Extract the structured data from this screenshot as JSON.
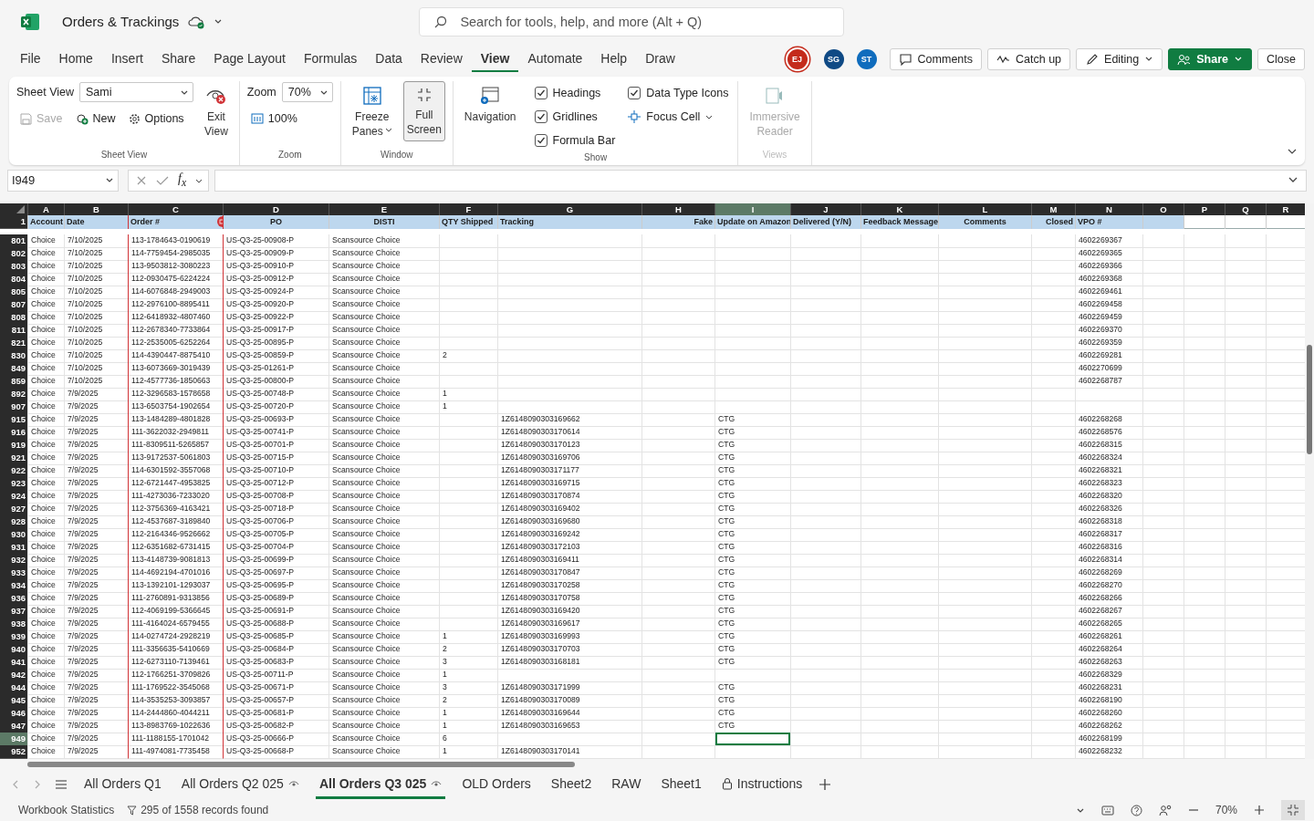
{
  "app": {
    "title": "Orders & Trackings",
    "search_placeholder": "Search for tools, help, and more (Alt + Q)"
  },
  "menu": [
    {
      "label": "File",
      "selected": false
    },
    {
      "label": "Home",
      "selected": false
    },
    {
      "label": "Insert",
      "selected": false
    },
    {
      "label": "Share",
      "selected": false
    },
    {
      "label": "Page Layout",
      "selected": false
    },
    {
      "label": "Formulas",
      "selected": false
    },
    {
      "label": "Data",
      "selected": false
    },
    {
      "label": "Review",
      "selected": false
    },
    {
      "label": "View",
      "selected": true
    },
    {
      "label": "Automate",
      "selected": false
    },
    {
      "label": "Help",
      "selected": false
    },
    {
      "label": "Draw",
      "selected": false
    }
  ],
  "presence": [
    {
      "initials": "EJ",
      "color": "#c42b1c"
    },
    {
      "initials": "SG",
      "color": "#0f4a85"
    },
    {
      "initials": "ST",
      "color": "#0f6cbd"
    }
  ],
  "header_buttons": [
    {
      "kind": "comments",
      "label": "Comments"
    },
    {
      "kind": "catchup",
      "label": "Catch up"
    },
    {
      "kind": "editing",
      "label": "Editing"
    },
    {
      "kind": "share",
      "label": "Share"
    },
    {
      "kind": "close",
      "label": "Close"
    }
  ],
  "ribbon": {
    "sheet_view": {
      "label": "Sheet View",
      "value": "Sami",
      "save": {
        "label": "Save",
        "disabled": true
      },
      "new": "New",
      "options": "Options",
      "exit": [
        "Exit",
        "View"
      ],
      "group": "Sheet View"
    },
    "zoom": {
      "label": "Zoom",
      "value": "70%",
      "hundred": "100%",
      "group": "Zoom"
    },
    "window": {
      "freeze": [
        "Freeze",
        "Panes"
      ],
      "full_screen": {
        "lines": [
          "Full",
          "Screen"
        ],
        "selected": true
      },
      "group": "Window"
    },
    "show": {
      "navigation": "Navigation",
      "checks": [
        {
          "label": "Headings",
          "checked": true
        },
        {
          "label": "Gridlines",
          "checked": true
        },
        {
          "label": "Formula Bar",
          "checked": true
        },
        {
          "label": "Data Type Icons",
          "checked": true
        }
      ],
      "focus_cell": "Focus Cell",
      "group": "Show"
    },
    "views": {
      "reader": {
        "lines": [
          "Immersive",
          "Reader"
        ],
        "disabled": true
      },
      "group": "Views",
      "disabled": true
    }
  },
  "formula_bar": {
    "name_box": "I949",
    "fx": "f$_{x}$"
  },
  "sheet": {
    "columns": [
      {
        "letter": "A",
        "heading": "Account",
        "selected": false
      },
      {
        "letter": "B",
        "heading": "Date",
        "selected": false
      },
      {
        "letter": "C",
        "heading": "Order #",
        "selected": false
      },
      {
        "letter": "D",
        "heading": "PO",
        "selected": false
      },
      {
        "letter": "E",
        "heading": "DISTI",
        "selected": false
      },
      {
        "letter": "F",
        "heading": "QTY Shipped",
        "selected": false
      },
      {
        "letter": "G",
        "heading": "Tracking",
        "selected": false
      },
      {
        "letter": "H",
        "heading": "Fake",
        "selected": false
      },
      {
        "letter": "I",
        "heading": "Update on Amazon",
        "selected": true
      },
      {
        "letter": "J",
        "heading": "Delivered (Y/N)",
        "selected": false
      },
      {
        "letter": "K",
        "heading": "Feedback Message",
        "selected": false
      },
      {
        "letter": "L",
        "heading": "Comments",
        "selected": false
      },
      {
        "letter": "M",
        "heading": "Closed",
        "selected": false
      },
      {
        "letter": "N",
        "heading": "VPO #",
        "selected": false
      },
      {
        "letter": "O",
        "selected": false
      },
      {
        "letter": "P",
        "selected": false
      },
      {
        "letter": "Q",
        "selected": false
      },
      {
        "letter": "R",
        "selected": false
      }
    ],
    "header_row": "1",
    "rows": [
      {
        "row": "801",
        "selected": false,
        "account": "Choice",
        "date": "7/10/2025",
        "order": "113-1784643-0190619",
        "po": "US-Q3-25-00908-P",
        "disti": "Scansource Choice",
        "vpo": "4602269367"
      },
      {
        "row": "802",
        "selected": false,
        "account": "Choice",
        "date": "7/10/2025",
        "order": "114-7759454-2985035",
        "po": "US-Q3-25-00909-P",
        "disti": "Scansource Choice",
        "vpo": "4602269365"
      },
      {
        "row": "803",
        "selected": false,
        "account": "Choice",
        "date": "7/10/2025",
        "order": "113-9503812-3080223",
        "po": "US-Q3-25-00910-P",
        "disti": "Scansource Choice",
        "vpo": "4602269366"
      },
      {
        "row": "804",
        "selected": false,
        "account": "Choice",
        "date": "7/10/2025",
        "order": "112-0930475-6224224",
        "po": "US-Q3-25-00912-P",
        "disti": "Scansource Choice",
        "vpo": "4602269368"
      },
      {
        "row": "805",
        "selected": false,
        "account": "Choice",
        "date": "7/10/2025",
        "order": "114-6076848-2949003",
        "po": "US-Q3-25-00924-P",
        "disti": "Scansource Choice",
        "vpo": "4602269461"
      },
      {
        "row": "807",
        "selected": false,
        "account": "Choice",
        "date": "7/10/2025",
        "order": "112-2976100-8895411",
        "po": "US-Q3-25-00920-P",
        "disti": "Scansource Choice",
        "vpo": "4602269458"
      },
      {
        "row": "808",
        "selected": false,
        "account": "Choice",
        "date": "7/10/2025",
        "order": "112-6418932-4807460",
        "po": "US-Q3-25-00922-P",
        "disti": "Scansource Choice",
        "vpo": "4602269459"
      },
      {
        "row": "811",
        "selected": false,
        "account": "Choice",
        "date": "7/10/2025",
        "order": "112-2678340-7733864",
        "po": "US-Q3-25-00917-P",
        "disti": "Scansource Choice",
        "vpo": "4602269370"
      },
      {
        "row": "821",
        "selected": false,
        "account": "Choice",
        "date": "7/10/2025",
        "order": "112-2535005-6252264",
        "po": "US-Q3-25-00895-P",
        "disti": "Scansource Choice",
        "vpo": "4602269359"
      },
      {
        "row": "830",
        "selected": false,
        "account": "Choice",
        "date": "7/10/2025",
        "order": "114-4390447-8875410",
        "po": "US-Q3-25-00859-P",
        "disti": "Scansource Choice",
        "qty": "2",
        "vpo": "4602269281"
      },
      {
        "row": "849",
        "selected": false,
        "account": "Choice",
        "date": "7/10/2025",
        "order": "113-6073669-3019439",
        "po": "US-Q3-25-01261-P",
        "disti": "Scansource Choice",
        "vpo": "4602270699"
      },
      {
        "row": "859",
        "selected": false,
        "account": "Choice",
        "date": "7/10/2025",
        "order": "112-4577736-1850663",
        "po": "US-Q3-25-00800-P",
        "disti": "Scansource Choice",
        "vpo": "4602268787"
      },
      {
        "row": "892",
        "selected": false,
        "account": "Choice",
        "date": "7/9/2025",
        "order": "112-3296583-1578658",
        "po": "US-Q3-25-00748-P",
        "disti": "Scansource Choice",
        "qty": "1"
      },
      {
        "row": "907",
        "selected": false,
        "account": "Choice",
        "date": "7/9/2025",
        "order": "113-6503754-1902654",
        "po": "US-Q3-25-00720-P",
        "disti": "Scansource Choice",
        "qty": "1"
      },
      {
        "row": "915",
        "selected": false,
        "account": "Choice",
        "date": "7/9/2025",
        "order": "113-1484289-4801828",
        "po": "US-Q3-25-00693-P",
        "disti": "Scansource Choice",
        "tracking": "1Z6148090303169662",
        "update": "CTG",
        "vpo": "4602268268"
      },
      {
        "row": "916",
        "selected": false,
        "account": "Choice",
        "date": "7/9/2025",
        "order": "111-3622032-2949811",
        "po": "US-Q3-25-00741-P",
        "disti": "Scansource Choice",
        "tracking": "1Z6148090303170614",
        "update": "CTG",
        "vpo": "4602268576"
      },
      {
        "row": "919",
        "selected": false,
        "account": "Choice",
        "date": "7/9/2025",
        "order": "111-8309511-5265857",
        "po": "US-Q3-25-00701-P",
        "disti": "Scansource Choice",
        "tracking": "1Z6148090303170123",
        "update": "CTG",
        "vpo": "4602268315"
      },
      {
        "row": "921",
        "selected": false,
        "account": "Choice",
        "date": "7/9/2025",
        "order": "113-9172537-5061803",
        "po": "US-Q3-25-00715-P",
        "disti": "Scansource Choice",
        "tracking": "1Z6148090303169706",
        "update": "CTG",
        "vpo": "4602268324"
      },
      {
        "row": "922",
        "selected": false,
        "account": "Choice",
        "date": "7/9/2025",
        "order": "114-6301592-3557068",
        "po": "US-Q3-25-00710-P",
        "disti": "Scansource Choice",
        "tracking": "1Z6148090303171177",
        "update": "CTG",
        "vpo": "4602268321"
      },
      {
        "row": "923",
        "selected": false,
        "account": "Choice",
        "date": "7/9/2025",
        "order": "112-6721447-4953825",
        "po": "US-Q3-25-00712-P",
        "disti": "Scansource Choice",
        "tracking": "1Z6148090303169715",
        "update": "CTG",
        "vpo": "4602268323"
      },
      {
        "row": "924",
        "selected": false,
        "account": "Choice",
        "date": "7/9/2025",
        "order": "111-4273036-7233020",
        "po": "US-Q3-25-00708-P",
        "disti": "Scansource Choice",
        "tracking": "1Z6148090303170874",
        "update": "CTG",
        "vpo": "4602268320"
      },
      {
        "row": "927",
        "selected": false,
        "account": "Choice",
        "date": "7/9/2025",
        "order": "112-3756369-4163421",
        "po": "US-Q3-25-00718-P",
        "disti": "Scansource Choice",
        "tracking": "1Z6148090303169402",
        "update": "CTG",
        "vpo": "4602268326"
      },
      {
        "row": "928",
        "selected": false,
        "account": "Choice",
        "date": "7/9/2025",
        "order": "112-4537687-3189840",
        "po": "US-Q3-25-00706-P",
        "disti": "Scansource Choice",
        "tracking": "1Z6148090303169680",
        "update": "CTG",
        "vpo": "4602268318"
      },
      {
        "row": "930",
        "selected": false,
        "account": "Choice",
        "date": "7/9/2025",
        "order": "112-2164346-9526662",
        "po": "US-Q3-25-00705-P",
        "disti": "Scansource Choice",
        "tracking": "1Z6148090303169242",
        "update": "CTG",
        "vpo": "4602268317"
      },
      {
        "row": "931",
        "selected": false,
        "account": "Choice",
        "date": "7/9/2025",
        "order": "112-6351682-6731415",
        "po": "US-Q3-25-00704-P",
        "disti": "Scansource Choice",
        "tracking": "1Z6148090303172103",
        "update": "CTG",
        "vpo": "4602268316"
      },
      {
        "row": "932",
        "selected": false,
        "account": "Choice",
        "date": "7/9/2025",
        "order": "113-4148739-9081813",
        "po": "US-Q3-25-00699-P",
        "disti": "Scansource Choice",
        "tracking": "1Z6148090303169411",
        "update": "CTG",
        "vpo": "4602268314"
      },
      {
        "row": "933",
        "selected": false,
        "account": "Choice",
        "date": "7/9/2025",
        "order": "114-4692194-4701016",
        "po": "US-Q3-25-00697-P",
        "disti": "Scansource Choice",
        "tracking": "1Z6148090303170847",
        "update": "CTG",
        "vpo": "4602268269"
      },
      {
        "row": "934",
        "selected": false,
        "account": "Choice",
        "date": "7/9/2025",
        "order": "113-1392101-1293037",
        "po": "US-Q3-25-00695-P",
        "disti": "Scansource Choice",
        "tracking": "1Z6148090303170258",
        "update": "CTG",
        "vpo": "4602268270"
      },
      {
        "row": "936",
        "selected": false,
        "account": "Choice",
        "date": "7/9/2025",
        "order": "111-2760891-9313856",
        "po": "US-Q3-25-00689-P",
        "disti": "Scansource Choice",
        "tracking": "1Z6148090303170758",
        "update": "CTG",
        "vpo": "4602268266"
      },
      {
        "row": "937",
        "selected": false,
        "account": "Choice",
        "date": "7/9/2025",
        "order": "112-4069199-5366645",
        "po": "US-Q3-25-00691-P",
        "disti": "Scansource Choice",
        "tracking": "1Z6148090303169420",
        "update": "CTG",
        "vpo": "4602268267"
      },
      {
        "row": "938",
        "selected": false,
        "account": "Choice",
        "date": "7/9/2025",
        "order": "111-4164024-6579455",
        "po": "US-Q3-25-00688-P",
        "disti": "Scansource Choice",
        "tracking": "1Z6148090303169617",
        "update": "CTG",
        "vpo": "4602268265"
      },
      {
        "row": "939",
        "selected": false,
        "account": "Choice",
        "date": "7/9/2025",
        "order": "114-0274724-2928219",
        "po": "US-Q3-25-00685-P",
        "disti": "Scansource Choice",
        "qty": "1",
        "tracking": "1Z6148090303169993",
        "update": "CTG",
        "vpo": "4602268261"
      },
      {
        "row": "940",
        "selected": false,
        "account": "Choice",
        "date": "7/9/2025",
        "order": "111-3356635-5410669",
        "po": "US-Q3-25-00684-P",
        "disti": "Scansource Choice",
        "qty": "2",
        "tracking": "1Z6148090303170703",
        "update": "CTG",
        "vpo": "4602268264"
      },
      {
        "row": "941",
        "selected": false,
        "account": "Choice",
        "date": "7/9/2025",
        "order": "112-6273110-7139461",
        "po": "US-Q3-25-00683-P",
        "disti": "Scansource Choice",
        "qty": "3",
        "tracking": "1Z6148090303168181",
        "update": "CTG",
        "vpo": "4602268263"
      },
      {
        "row": "942",
        "selected": false,
        "account": "Choice",
        "date": "7/9/2025",
        "order": "112-1766251-3709826",
        "po": "US-Q3-25-00711-P",
        "disti": "Scansource Choice",
        "qty": "1",
        "vpo": "4602268329"
      },
      {
        "row": "944",
        "selected": false,
        "account": "Choice",
        "date": "7/9/2025",
        "order": "111-1769522-3545068",
        "po": "US-Q3-25-00671-P",
        "disti": "Scansource Choice",
        "qty": "3",
        "tracking": "1Z6148090303171999",
        "update": "CTG",
        "vpo": "4602268231"
      },
      {
        "row": "945",
        "selected": false,
        "account": "Choice",
        "date": "7/9/2025",
        "order": "114-3535253-3093857",
        "po": "US-Q3-25-00657-P",
        "disti": "Scansource Choice",
        "qty": "2",
        "tracking": "1Z6148090303170089",
        "update": "CTG",
        "vpo": "4602268190"
      },
      {
        "row": "946",
        "selected": false,
        "account": "Choice",
        "date": "7/9/2025",
        "order": "114-2444860-4044211",
        "po": "US-Q3-25-00681-P",
        "disti": "Scansource Choice",
        "qty": "1",
        "tracking": "1Z6148090303169644",
        "update": "CTG",
        "vpo": "4602268260"
      },
      {
        "row": "947",
        "selected": false,
        "account": "Choice",
        "date": "7/9/2025",
        "order": "113-8983769-1022636",
        "po": "US-Q3-25-00682-P",
        "disti": "Scansource Choice",
        "qty": "1",
        "tracking": "1Z6148090303169653",
        "update": "CTG",
        "vpo": "4602268262"
      },
      {
        "row": "949",
        "selected": true,
        "account": "Choice",
        "date": "7/9/2025",
        "order": "111-1188155-1701042",
        "po": "US-Q3-25-00666-P",
        "disti": "Scansource Choice",
        "qty": "6",
        "vpo": "4602268199"
      },
      {
        "row": "952",
        "selected": false,
        "account": "Choice",
        "date": "7/9/2025",
        "order": "111-4974081-7735458",
        "po": "US-Q3-25-00668-P",
        "disti": "Scansource Choice",
        "qty": "1",
        "tracking": "1Z6148090303170141",
        "vpo": "4602268232"
      }
    ]
  },
  "sheet_tabs": [
    {
      "label": "All Orders Q1",
      "selected": false,
      "kind": "plain"
    },
    {
      "label": "All Orders Q2 025",
      "selected": false,
      "kind": "watched"
    },
    {
      "label": "All Orders Q3 025",
      "selected": true,
      "kind": "watched"
    },
    {
      "label": "OLD Orders",
      "selected": false,
      "kind": "plain"
    },
    {
      "label": "Sheet2",
      "selected": false,
      "kind": "plain"
    },
    {
      "label": "RAW",
      "selected": false,
      "kind": "plain"
    },
    {
      "label": "Sheet1",
      "selected": false,
      "kind": "plain"
    },
    {
      "label": "Instructions",
      "selected": false,
      "kind": "locked"
    }
  ],
  "status_bar": {
    "statistics": "Workbook Statistics",
    "filter": "295 of 1558 records found",
    "zoom": "70%"
  }
}
